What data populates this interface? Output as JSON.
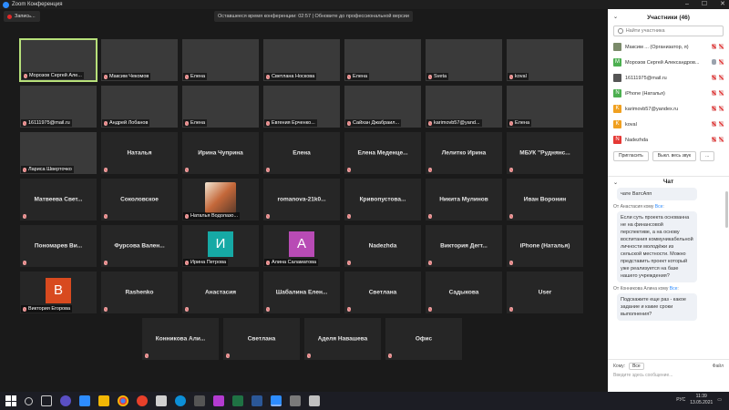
{
  "window": {
    "title": "Zoom Конференция"
  },
  "top": {
    "record_label": "Запись...",
    "notice": "Оставшееся время конференции: 02:57 | Обновите до профессиональной версии"
  },
  "tiles": [
    {
      "name": "Морозов Сергей Але...",
      "kind": "video",
      "active": true
    },
    {
      "name": "Максим Чекомов",
      "kind": "video"
    },
    {
      "name": "Елена",
      "kind": "video"
    },
    {
      "name": "Светлана Носкова",
      "kind": "video"
    },
    {
      "name": "Елена",
      "kind": "video"
    },
    {
      "name": "Sveta",
      "kind": "video"
    },
    {
      "name": "koval",
      "kind": "video"
    },
    {
      "name": "16111975@mail.ru",
      "kind": "video"
    },
    {
      "name": "Андрей Лобанов",
      "kind": "video"
    },
    {
      "name": "Елена",
      "kind": "video"
    },
    {
      "name": "Евгения Ерченко...",
      "kind": "video"
    },
    {
      "name": "Сайхан Джабраил...",
      "kind": "video"
    },
    {
      "name": "karimovb57@yand...",
      "kind": "video"
    },
    {
      "name": "Елена",
      "kind": "video"
    },
    {
      "name": "Лариса Шверточко",
      "kind": "video"
    },
    {
      "name": "Наталья",
      "kind": "name"
    },
    {
      "name": "Ирина Чуприна",
      "kind": "name"
    },
    {
      "name": "Елена",
      "kind": "name"
    },
    {
      "name": "Елена Меденце...",
      "kind": "name"
    },
    {
      "name": "Лелитко Ирина",
      "kind": "name"
    },
    {
      "name": "МБУК \"Руднянс...",
      "kind": "name"
    },
    {
      "name": "Матвеева Свет...",
      "kind": "name"
    },
    {
      "name": "Соколовское",
      "kind": "name"
    },
    {
      "name": "Наталья Водолазо...",
      "kind": "photo"
    },
    {
      "name": "romanova-21k0...",
      "kind": "name"
    },
    {
      "name": "Кривопустова...",
      "kind": "name"
    },
    {
      "name": "Никита Мулинов",
      "kind": "name"
    },
    {
      "name": "Иван Воронин",
      "kind": "name"
    },
    {
      "name": "Пономарев Ви...",
      "kind": "name"
    },
    {
      "name": "Фурсова Вален...",
      "kind": "name"
    },
    {
      "name": "Ирина Петрова",
      "kind": "avatar",
      "letter": "И",
      "color": "#16a9a5"
    },
    {
      "name": "Алина Саламатова",
      "kind": "avatar",
      "letter": "А",
      "color": "#b84bb5"
    },
    {
      "name": "Nadezhda",
      "kind": "name"
    },
    {
      "name": "Виктория Дегт...",
      "kind": "name"
    },
    {
      "name": "iPhone (Наталья)",
      "kind": "name"
    },
    {
      "name": "Виктория Егорова",
      "kind": "avatar",
      "letter": "В",
      "color": "#d84a1f"
    },
    {
      "name": "Rashenko",
      "kind": "name"
    },
    {
      "name": "Анастасия",
      "kind": "name"
    },
    {
      "name": "Шабалина Елен...",
      "kind": "name"
    },
    {
      "name": "Светлана",
      "kind": "name"
    },
    {
      "name": "Садыкова",
      "kind": "name"
    },
    {
      "name": "User",
      "kind": "name"
    },
    {
      "name": "Конникова Али...",
      "kind": "name"
    },
    {
      "name": "Светлана",
      "kind": "name"
    },
    {
      "name": "Аделя Навашева",
      "kind": "name"
    },
    {
      "name": "Офис",
      "kind": "name"
    }
  ],
  "participants_panel": {
    "title": "Участники (46)",
    "search_placeholder": "Найти участника",
    "items": [
      {
        "name": "Максим ... (Организатор, я)",
        "initial": "",
        "color": "#7a8a6a",
        "mic": "off",
        "cam": "off"
      },
      {
        "name": "Морозов Сергей Александров...",
        "initial": "М",
        "color": "#4caf50",
        "mic": "on",
        "cam": "off"
      },
      {
        "name": "16111975@mail.ru",
        "initial": "",
        "color": "#555555",
        "mic": "off",
        "cam": "off"
      },
      {
        "name": "iPhone (Наталья)",
        "initial": "N",
        "color": "#4caf50",
        "mic": "off",
        "cam": "off"
      },
      {
        "name": "karimovb57@yandex.ru",
        "initial": "K",
        "color": "#f0a020",
        "mic": "off",
        "cam": "off"
      },
      {
        "name": "koval",
        "initial": "K",
        "color": "#f0a020",
        "mic": "off",
        "cam": "off"
      },
      {
        "name": "Nadezhda",
        "initial": "N",
        "color": "#e53935",
        "mic": "off",
        "cam": "off"
      }
    ],
    "invite_label": "Пригласить",
    "mute_all_label": "Выкл. весь звук",
    "more_label": "..."
  },
  "chat": {
    "title": "Чат",
    "messages": [
      {
        "from": "",
        "to": "",
        "text": "чате ВатсАпп"
      },
      {
        "from": "Анастасия",
        "to": "Все",
        "text": "Если суть проекта основанна не на финансовой перспективе, а на основу воспитания коммуникабельной личности молодёжи из сельской местности. Можно представить проект который уже реализуется на базе нашего учреждения?"
      },
      {
        "from": "Конникова Алина",
        "to": "Все",
        "text": "Подскажите еще раз - какое задание и какие сроки выполнения?"
      }
    ],
    "from_prefix": "От",
    "to_word": "кому",
    "to_label": "Кому:",
    "to_value": "Все",
    "file_label": "Файл",
    "input_placeholder": "Введите здесь сообщение..."
  },
  "taskbar": {
    "lang": "РУС",
    "time": "11:39",
    "date": "13.05.2021"
  }
}
